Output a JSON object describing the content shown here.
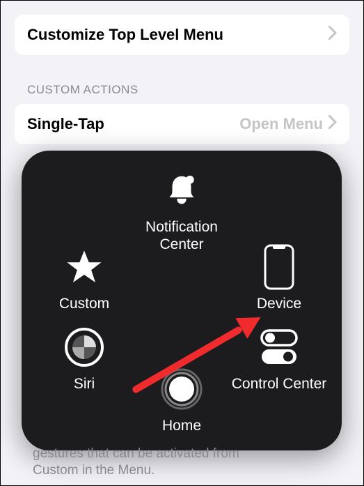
{
  "top_card": {
    "title": "Customize Top Level Menu"
  },
  "section_header": "CUSTOM ACTIONS",
  "single_tap": {
    "label": "Single-Tap",
    "value": "Open Menu"
  },
  "overlay": {
    "notification": "Notification Center",
    "custom": "Custom",
    "device": "Device",
    "siri": "Siri",
    "control_center": "Control Center",
    "home": "Home"
  },
  "footer_line1": "gestures that can be activated from",
  "footer_line2": "Custom in the Menu."
}
